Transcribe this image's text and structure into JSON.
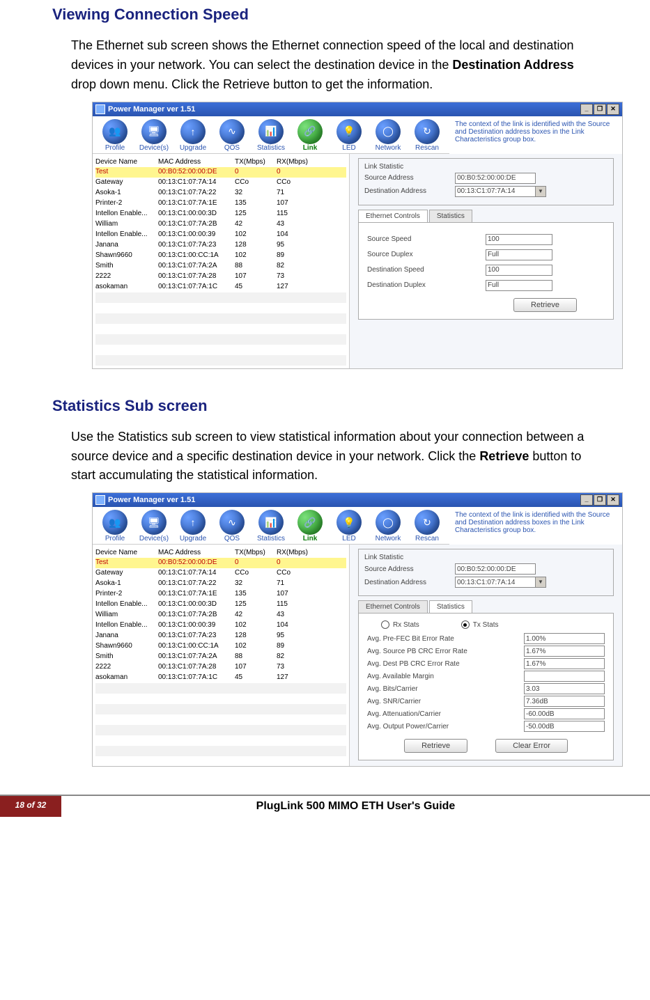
{
  "heading1": "Viewing Connection Speed",
  "para1a": "The Ethernet sub screen shows the Ethernet connection speed of the local and destination devices in your network. You can select the destination device in the ",
  "para1b": "Destination Address",
  "para1c": " drop down menu. Click the Retrieve button to get the information.",
  "heading2": "Statistics Sub screen",
  "para2a": "Use the Statistics sub screen to view statistical information about your connection between a source device and a specific destination device in your network. Click the ",
  "para2b": "Retrieve",
  "para2c": " button to start accumulating the statistical information.",
  "footer": {
    "page": "18 of 32",
    "guide": "PlugLink 500 MIMO ETH User's Guide"
  },
  "app": {
    "title": "Power Manager ver 1.51",
    "hint": "The context of the link is identified with the Source and Destination address boxes in the Link Characteristics group box.",
    "winbtns": [
      "_",
      "❐",
      "✕"
    ],
    "toolbar": [
      {
        "label": "Profile",
        "glyph": "👥"
      },
      {
        "label": "Device(s)",
        "glyph": "🖥"
      },
      {
        "label": "Upgrade",
        "glyph": "↑"
      },
      {
        "label": "QOS",
        "glyph": "∿"
      },
      {
        "label": "Statistics",
        "glyph": "📊"
      },
      {
        "label": "Link",
        "glyph": "🔗",
        "active": true
      },
      {
        "label": "LED",
        "glyph": "💡"
      },
      {
        "label": "Network",
        "glyph": "◯"
      },
      {
        "label": "Rescan",
        "glyph": "↻"
      }
    ],
    "dev_headers": [
      "Device Name",
      "MAC Address",
      "TX(Mbps)",
      "RX(Mbps)"
    ],
    "devices": [
      {
        "n": "Test",
        "m": "00:B0:52:00:00:DE",
        "tx": "0",
        "rx": "0",
        "sel": true
      },
      {
        "n": "Gateway",
        "m": "00:13:C1:07:7A:14",
        "tx": "CCo",
        "rx": "CCo"
      },
      {
        "n": "Asoka-1",
        "m": "00:13:C1:07:7A:22",
        "tx": "32",
        "rx": "71"
      },
      {
        "n": "Printer-2",
        "m": "00:13:C1:07:7A:1E",
        "tx": "135",
        "rx": "107"
      },
      {
        "n": "Intellon Enable...",
        "m": "00:13:C1:00:00:3D",
        "tx": "125",
        "rx": "115"
      },
      {
        "n": "William",
        "m": "00:13:C1:07:7A:2B",
        "tx": "42",
        "rx": "43"
      },
      {
        "n": "Intellon Enable...",
        "m": "00:13:C1:00:00:39",
        "tx": "102",
        "rx": "104"
      },
      {
        "n": "Janana",
        "m": "00:13:C1:07:7A:23",
        "tx": "128",
        "rx": "95"
      },
      {
        "n": "Shawn9660",
        "m": "00:13:C1:00:CC:1A",
        "tx": "102",
        "rx": "89"
      },
      {
        "n": "Smith",
        "m": "00:13:C1:07:7A:2A",
        "tx": "88",
        "rx": "82"
      },
      {
        "n": "2222",
        "m": "00:13:C1:07:7A:28",
        "tx": "107",
        "rx": "73"
      },
      {
        "n": "asokaman",
        "m": "00:13:C1:07:7A:1C",
        "tx": "45",
        "rx": "127"
      }
    ],
    "linkstat": {
      "legend": "Link Statistic",
      "src_label": "Source Address",
      "dst_label": "Destination Address",
      "src_val": "00:B0:52:00:00:DE",
      "dst_val": "00:13:C1:07:7A:14"
    },
    "tabs": {
      "eth": "Ethernet Controls",
      "stat": "Statistics"
    },
    "eth": {
      "rows": [
        {
          "l": "Source Speed",
          "v": "100"
        },
        {
          "l": "Source Duplex",
          "v": "Full"
        },
        {
          "l": "Destination Speed",
          "v": "100"
        },
        {
          "l": "Destination Duplex",
          "v": "Full"
        }
      ],
      "btn": "Retrieve"
    },
    "stats": {
      "radio_rx": "Rx Stats",
      "radio_tx": "Tx Stats",
      "rows": [
        {
          "l": "Avg. Pre-FEC Bit Error Rate",
          "v": "1.00%"
        },
        {
          "l": "Avg. Source PB CRC Error Rate",
          "v": "1.67%"
        },
        {
          "l": "Avg. Dest PB CRC Error Rate",
          "v": "1.67%"
        },
        {
          "l": "Avg. Available Margin",
          "v": ""
        },
        {
          "l": "Avg. Bits/Carrier",
          "v": "3.03"
        },
        {
          "l": "Avg. SNR/Carrier",
          "v": "7.36dB"
        },
        {
          "l": "Avg. Attenuation/Carrier",
          "v": "-60.00dB"
        },
        {
          "l": "Avg. Output Power/Carrier",
          "v": "-50.00dB"
        }
      ],
      "btn_retrieve": "Retrieve",
      "btn_clear": "Clear Error"
    }
  }
}
